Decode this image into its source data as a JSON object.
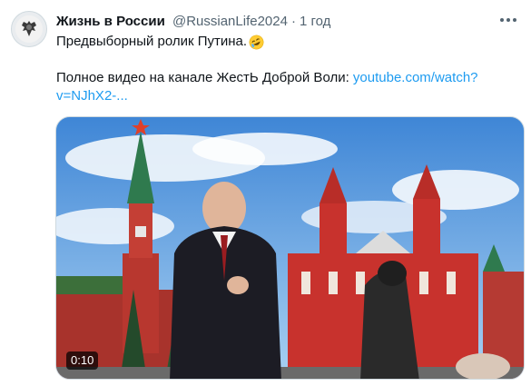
{
  "tweet": {
    "author_name": "Жизнь в России",
    "handle": "@RussianLife2024",
    "separator": "·",
    "time": "1 год",
    "text_line1": "Предвыборный ролик Путина.",
    "emoji": "rolling-on-floor-laughing-emoji",
    "text_line2": "Полное видео на канале ЖестЬ Доброй Воли:",
    "link_text": "youtube.com/watch?v=NJhX2-..."
  },
  "video": {
    "duration_label": "0:10"
  },
  "icons": {
    "avatar": "double-headed-eagle-icon",
    "more": "more-icon"
  },
  "colors": {
    "link": "#1d9bf0",
    "secondary_text": "#536471",
    "sky": "#6aa8e0",
    "kremlin_red": "#c8322d"
  }
}
